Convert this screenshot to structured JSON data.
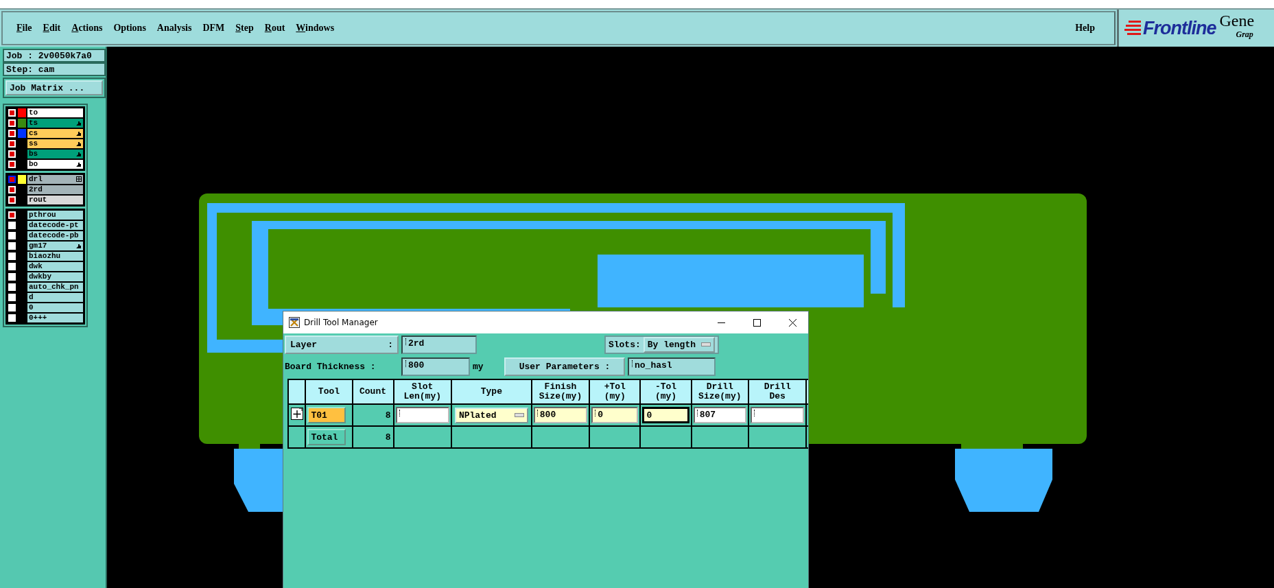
{
  "menu": [
    {
      "label": "File",
      "underlined": true
    },
    {
      "label": "Edit",
      "underlined": true
    },
    {
      "label": "Actions",
      "underlined": true
    },
    {
      "label": "Options",
      "underlined": false
    },
    {
      "label": "Analysis",
      "underlined": false
    },
    {
      "label": "DFM",
      "underlined": false
    },
    {
      "label": "Step",
      "underlined": true
    },
    {
      "label": "Rout",
      "underlined": true
    },
    {
      "label": "Windows",
      "underlined": true
    }
  ],
  "help": {
    "label": "Help"
  },
  "logo": {
    "brand": "Frontline",
    "product": "Gene",
    "subtitle": "Grap"
  },
  "job_panel": {
    "job": "Job : 2v0050k7a0",
    "step": "Step: cam",
    "matrix_button": "Job Matrix ..."
  },
  "layer_groups": [
    [
      {
        "name": "to",
        "kind": "silk_screen",
        "checked": true,
        "selected": false,
        "color": "#ff0000",
        "pointer": false,
        "grid_box": false
      },
      {
        "name": "ts",
        "kind": "solder_mask",
        "checked": true,
        "selected": false,
        "color": "#3a8a10",
        "pointer": true,
        "grid_box": false
      },
      {
        "name": "cs",
        "kind": "signal",
        "checked": true,
        "selected": false,
        "color": "#0033ff",
        "pointer": true,
        "grid_box": false
      },
      {
        "name": "ss",
        "kind": "signal",
        "checked": true,
        "selected": false,
        "pointer": true,
        "grid_box": false
      },
      {
        "name": "bs",
        "kind": "solder_mask",
        "checked": true,
        "selected": false,
        "pointer": true,
        "grid_box": false
      },
      {
        "name": "bo",
        "kind": "silk_screen",
        "checked": true,
        "selected": false,
        "pointer": true,
        "grid_box": false
      }
    ],
    [
      {
        "name": "drl",
        "kind": "drill",
        "checked": true,
        "selected": true,
        "color": "#ffff33",
        "pointer": false,
        "grid_box": true
      },
      {
        "name": "2rd",
        "kind": "drill",
        "checked": true,
        "selected": false,
        "pointer": false,
        "grid_box": false
      },
      {
        "name": "rout",
        "kind": "rout",
        "checked": true,
        "selected": false,
        "pointer": false,
        "grid_box": false
      }
    ],
    [
      {
        "name": "pthrou",
        "kind": "document",
        "checked": true,
        "selected": false,
        "pointer": false,
        "grid_box": false
      },
      {
        "name": "datecode-pt",
        "kind": "document",
        "checked": false,
        "selected": false,
        "pointer": false,
        "grid_box": false
      },
      {
        "name": "datecode-pb",
        "kind": "document",
        "checked": false,
        "selected": false,
        "pointer": false,
        "grid_box": false
      },
      {
        "name": "gm17",
        "kind": "document",
        "checked": false,
        "selected": false,
        "pointer": true,
        "grid_box": false
      },
      {
        "name": "biaozhu",
        "kind": "document",
        "checked": false,
        "selected": false,
        "pointer": false,
        "grid_box": false
      },
      {
        "name": "dwk",
        "kind": "document",
        "checked": false,
        "selected": false,
        "pointer": false,
        "grid_box": false
      },
      {
        "name": "dwkby",
        "kind": "document",
        "checked": false,
        "selected": false,
        "pointer": false,
        "grid_box": false
      },
      {
        "name": "auto_chk_pn",
        "kind": "document",
        "checked": false,
        "selected": false,
        "pointer": false,
        "grid_box": false
      },
      {
        "name": "d",
        "kind": "document",
        "checked": false,
        "selected": false,
        "pointer": false,
        "grid_box": false
      },
      {
        "name": "0",
        "kind": "document",
        "checked": false,
        "selected": false,
        "pointer": false,
        "grid_box": false
      },
      {
        "name": "0+++",
        "kind": "document",
        "checked": false,
        "selected": false,
        "pointer": false,
        "grid_box": false
      }
    ]
  ],
  "dialog": {
    "title": "Drill Tool Manager",
    "layer_label": "Layer",
    "layer_colon": ":",
    "layer_value": "2rd",
    "slots_label": "Slots:",
    "slots_value": "By length",
    "thickness_label": "Board Thickness :",
    "thickness_value": "800",
    "thickness_unit": "my",
    "user_params_label": "User Parameters :",
    "user_params_value": "no_hasl",
    "table": {
      "columns": [
        "Tool",
        "Count",
        "Slot\nLen(my)",
        "Type",
        "Finish\nSize(my)",
        "+Tol\n(my)",
        "-Tol\n(my)",
        "Drill\nSize(my)",
        "Drill\nDes"
      ],
      "rows": [
        {
          "kind": "tool",
          "tool": "T01",
          "count": "8",
          "cells": [
            {
              "kind": "entry",
              "focused": false
            },
            {
              "kind": "dropdown",
              "value": "NPlated",
              "focused": false
            },
            {
              "kind": "finish_entry",
              "value": "800",
              "focused": false
            },
            {
              "kind": "finish_entry",
              "value": "0",
              "focused": false
            },
            {
              "kind": "finish_entry",
              "value": "0",
              "focused": true
            },
            {
              "kind": "entry",
              "value": "807",
              "focused": false
            },
            {
              "kind": "entry",
              "focused": false
            }
          ]
        },
        {
          "kind": "total",
          "tool": "Total",
          "count": "8"
        }
      ]
    }
  }
}
